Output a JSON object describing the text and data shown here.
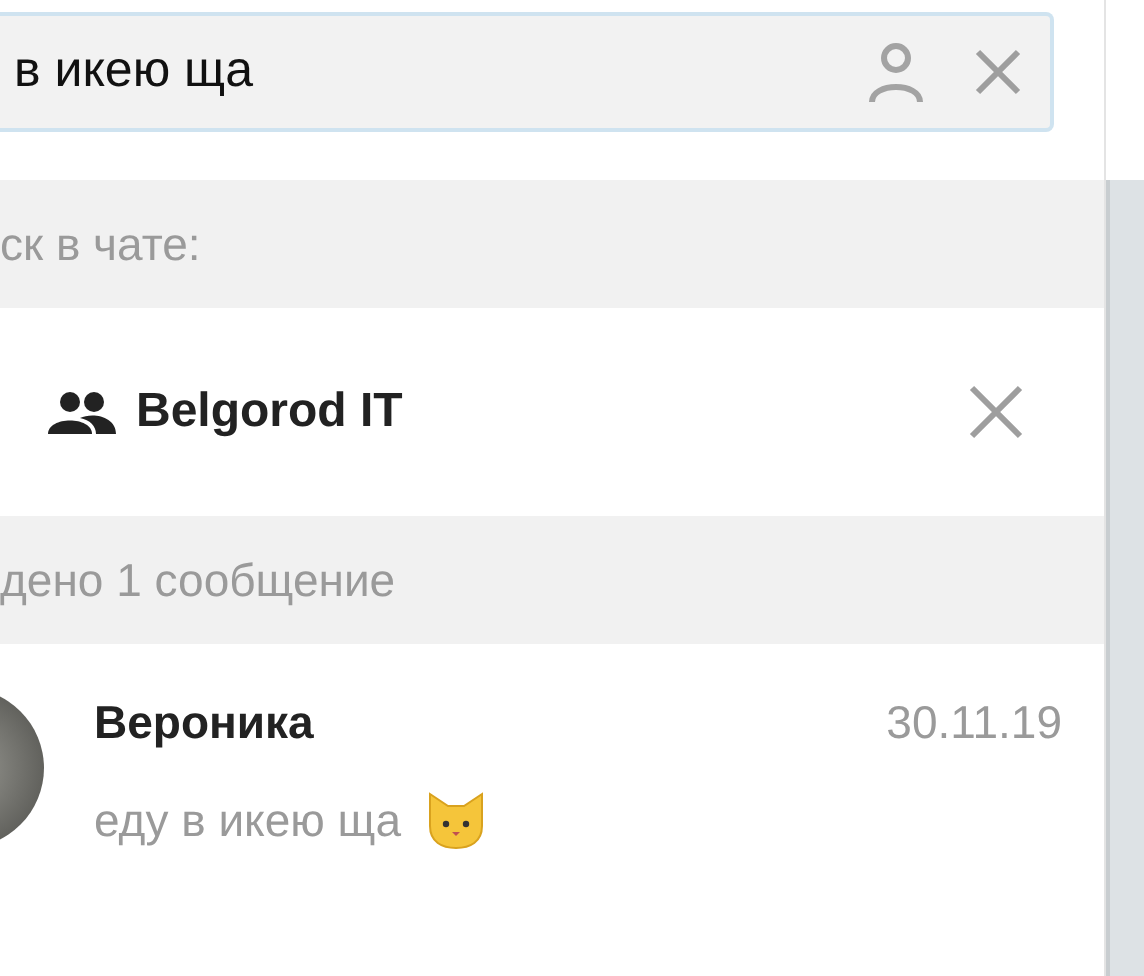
{
  "search": {
    "value": "в икею ща"
  },
  "chat_filter": {
    "header": "ск в чате:",
    "chat_name": "Belgorod IT"
  },
  "results": {
    "header": "дено 1 сообщение",
    "messages": [
      {
        "sender": "Вероника",
        "date": "30.11.19",
        "text": "еду в икею ща"
      }
    ]
  }
}
